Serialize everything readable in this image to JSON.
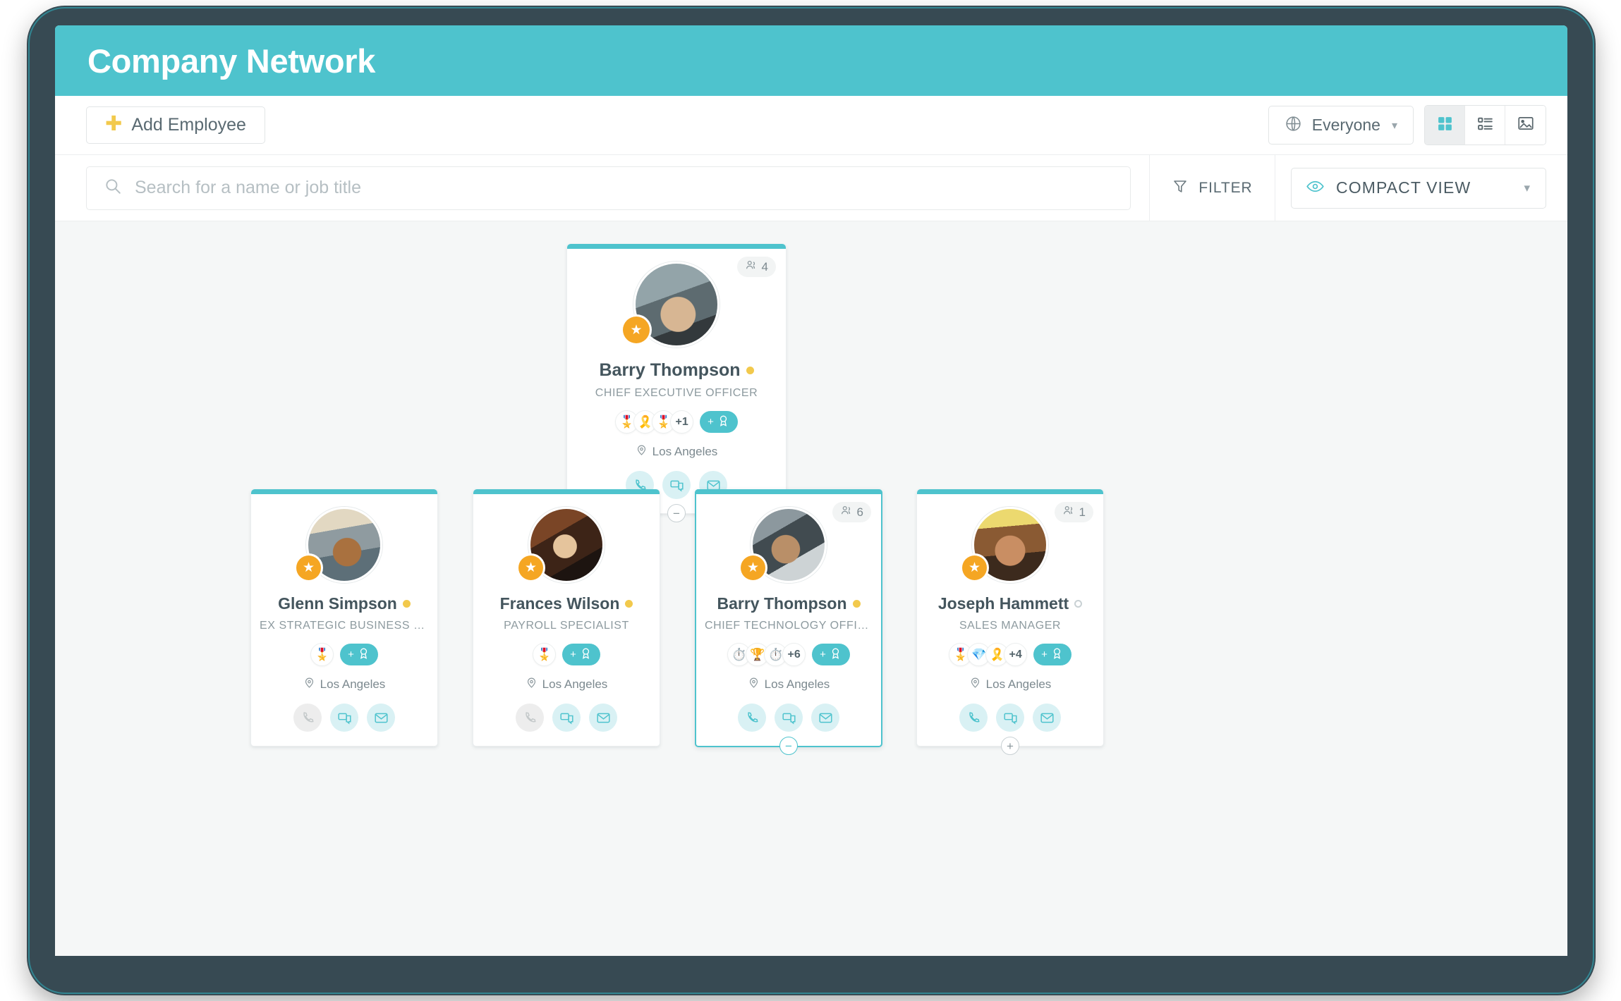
{
  "app": {
    "title": "Company Network",
    "accent": "#4ec3cd",
    "frame_color": "#374a53",
    "canvas_bg": "#f5f7f7"
  },
  "toolbar": {
    "add_employee_label": "Add Employee",
    "scope_label": "Everyone",
    "views": [
      {
        "name": "grid-view",
        "icon": "grid-icon",
        "active": true
      },
      {
        "name": "list-view",
        "icon": "list-icon",
        "active": false
      },
      {
        "name": "photo-view",
        "icon": "image-icon",
        "active": false
      }
    ]
  },
  "search": {
    "placeholder": "Search for a name or job title",
    "value": ""
  },
  "filter": {
    "label": "FILTER"
  },
  "compact": {
    "label": "COMPACT VIEW"
  },
  "chart": {
    "root": {
      "name": "Barry Thompson",
      "title": "CHIEF EXECUTIVE OFFICER",
      "location": "Los Angeles",
      "report_count": "4",
      "status": "away",
      "badges": [
        "🎖️",
        "🎗️",
        "🎖️"
      ],
      "badge_more": "+1",
      "add_badge_label": "+",
      "toggle": "−",
      "selected": false,
      "phone_enabled": true,
      "avatar_colors": [
        "#8c9aa0",
        "#4c5a5e",
        "#d6c6a8"
      ]
    },
    "children": [
      {
        "name": "Glenn Simpson",
        "title": "EX STRATEGIC BUSINESS DEVELOP...",
        "location": "Los Angeles",
        "report_count": "",
        "status": "away",
        "badges": [
          "🎖️"
        ],
        "badge_more": "",
        "add_badge_label": "+",
        "toggle": "",
        "selected": false,
        "phone_enabled": false,
        "avatar_colors": [
          "#ded3bd",
          "#9aa6ab",
          "#6d6257"
        ]
      },
      {
        "name": "Frances Wilson",
        "title": "PAYROLL SPECIALIST",
        "location": "Los Angeles",
        "report_count": "",
        "status": "away",
        "badges": [
          "🎖️"
        ],
        "badge_more": "",
        "add_badge_label": "+",
        "toggle": "",
        "selected": false,
        "phone_enabled": false,
        "avatar_colors": [
          "#5a3824",
          "#8d5b38",
          "#2b1d15"
        ]
      },
      {
        "name": "Barry Thompson",
        "title": "CHIEF TECHNOLOGY OFFICER",
        "location": "Los Angeles",
        "report_count": "6",
        "status": "away",
        "badges": [
          "⏱️",
          "🏆",
          "⏱️"
        ],
        "badge_more": "+6",
        "add_badge_label": "+",
        "toggle": "−",
        "selected": true,
        "phone_enabled": true,
        "avatar_colors": [
          "#77838a",
          "#3f4a50",
          "#b99a7d"
        ]
      },
      {
        "name": "Joseph Hammett",
        "title": "SALES MANAGER",
        "location": "Los Angeles",
        "report_count": "1",
        "status": "offline",
        "badges": [
          "🎖️",
          "💎",
          "🎗️"
        ],
        "badge_more": "+4",
        "add_badge_label": "+",
        "toggle": "+",
        "selected": false,
        "phone_enabled": true,
        "avatar_colors": [
          "#e8d46a",
          "#8a5a33",
          "#3c2a1d"
        ]
      }
    ]
  }
}
